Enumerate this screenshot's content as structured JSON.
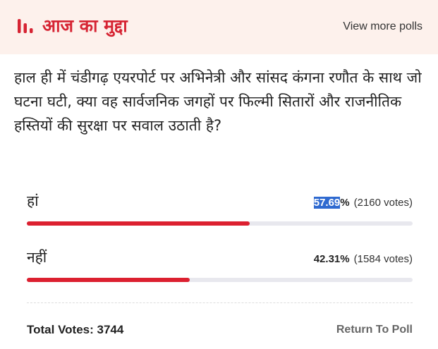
{
  "header": {
    "title": "आज का मुद्दा",
    "view_more": "View more polls",
    "icon": "poll-bars-icon",
    "accent_color": "#d62433"
  },
  "poll": {
    "question": "हाल ही में चंडीगढ़ एयरपोर्ट पर अभिनेत्री और सांसद कंगना रणौत के साथ जो घटना घटी, क्या वह सार्वजनिक जगहों पर फिल्मी सितारों और राजनीतिक हस्तियों की सुरक्षा पर सवाल उठाती है?",
    "options": [
      {
        "label": "हां",
        "percent_value": "57.69",
        "percent_sign": "%",
        "votes": "(2160 votes)",
        "fraction": 0.5769
      },
      {
        "label": "नहीं",
        "percent_value": "42.31",
        "percent_sign": "%",
        "votes": "(1584 votes)",
        "fraction": 0.4231
      }
    ],
    "bar_color": "#dc2030",
    "track_color": "#e8e8ee"
  },
  "footer": {
    "total_votes": "Total Votes: 3744",
    "return_label": "Return To Poll"
  }
}
